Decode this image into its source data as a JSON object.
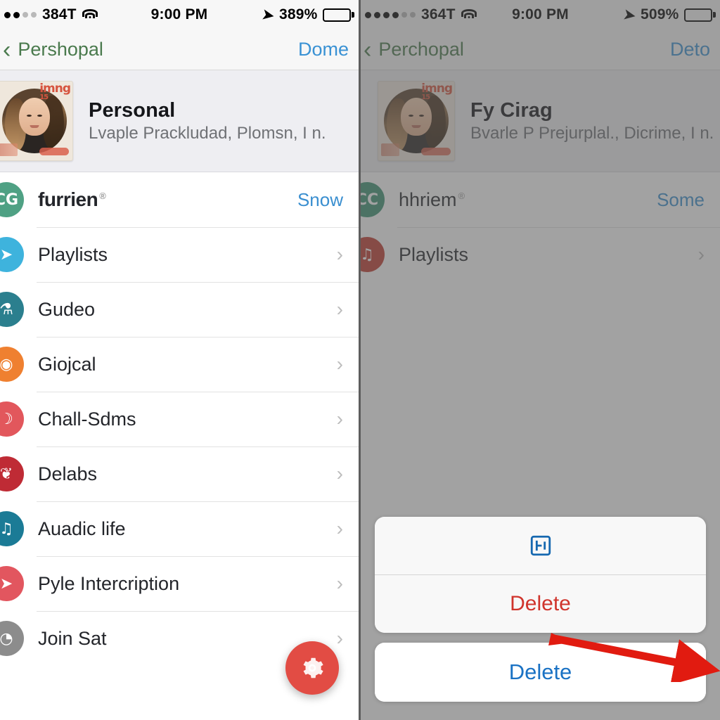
{
  "left_phone": {
    "status_bar": {
      "signal_dots_filled": 2,
      "signal_dots_total": 5,
      "carrier": "384T",
      "wifi_icon": "wifi-icon",
      "time": "9:00 PM",
      "location_icon": "location-arrow-icon",
      "battery_percent": "389%",
      "battery_icon": "battery-full-icon"
    },
    "nav_bar": {
      "back_icon": "chevron-left-icon",
      "back_label": "Pershopal",
      "right_action": "Dome"
    },
    "profile": {
      "avatar_name": "avatar",
      "avatar_watermark": "imng",
      "avatar_watermark_sub": "15",
      "name": "Personal",
      "subtitle": "Lvaple Prackludad, Plomsn, I n."
    },
    "rows": [
      {
        "label": "furrien",
        "sup": "®",
        "value": "Snow",
        "chevron": false,
        "icon_name": "furrien-icon",
        "icon_color": "#4fa184",
        "glyph": "CG",
        "brand": true
      },
      {
        "label": "Playlists",
        "sup": "",
        "value": "",
        "chevron": true,
        "icon_name": "playlists-icon",
        "icon_color": "#3eb3dd",
        "glyph": "➤",
        "brand": false
      },
      {
        "label": "Gudeo",
        "sup": "",
        "value": "",
        "chevron": true,
        "icon_name": "gudeo-icon",
        "icon_color": "#2b7f8e",
        "glyph": "⚗",
        "brand": false
      },
      {
        "label": "Giojcal",
        "sup": "",
        "value": "",
        "chevron": true,
        "icon_name": "giojcal-icon",
        "icon_color": "#ef8030",
        "glyph": "◉",
        "brand": false
      },
      {
        "label": "Chall-Sdms",
        "sup": "",
        "value": "",
        "chevron": true,
        "icon_name": "chall-sdms-icon",
        "icon_color": "#e2575c",
        "glyph": "☽",
        "brand": false
      },
      {
        "label": "Delabs",
        "sup": "",
        "value": "",
        "chevron": true,
        "icon_name": "delabs-icon",
        "icon_color": "#bf2b35",
        "glyph": "❦",
        "brand": false
      },
      {
        "label": "Auadic life",
        "sup": "",
        "value": "",
        "chevron": true,
        "icon_name": "auadic-life-icon",
        "icon_color": "#1b7b96",
        "glyph": "♫",
        "brand": false
      },
      {
        "label": "Pyle Intercription",
        "sup": "",
        "value": "",
        "chevron": true,
        "icon_name": "pyle-intercription-icon",
        "icon_color": "#e2565f",
        "glyph": "➤",
        "brand": false
      },
      {
        "label": "Join Sat",
        "sup": "",
        "value": "",
        "chevron": true,
        "icon_name": "join-sat-icon",
        "icon_color": "#8c8c8c",
        "glyph": "◔",
        "brand": false
      }
    ],
    "fab": {
      "icon_name": "gear-icon",
      "color": "#e24c44"
    }
  },
  "right_phone": {
    "status_bar": {
      "signal_dots_filled": 4,
      "signal_dots_total": 6,
      "carrier": "364T",
      "wifi_icon": "wifi-icon",
      "time": "9:00 PM",
      "location_icon": "location-arrow-icon",
      "battery_percent": "509%",
      "battery_icon": "battery-full-icon"
    },
    "nav_bar": {
      "back_icon": "chevron-left-icon",
      "back_label": "Perchopal",
      "right_action": "Deto"
    },
    "profile": {
      "avatar_name": "avatar",
      "avatar_watermark": "imng",
      "avatar_watermark_sub": "15",
      "name": "Fy Cirag",
      "subtitle": "Bvarle P Prejurplal., Dicrime, I n."
    },
    "rows": [
      {
        "label": "hhriem",
        "sup": "®",
        "value": "Some",
        "chevron": false,
        "icon_name": "hhriem-icon",
        "icon_color": "#3d9272",
        "glyph": "CC",
        "brand": false
      },
      {
        "label": "Playlists",
        "sup": "",
        "value": "",
        "chevron": true,
        "icon_name": "playlists-icon",
        "icon_color": "#c0392f",
        "glyph": "♫",
        "brand": false
      }
    ],
    "action_sheet": {
      "icon_name": "share-square-icon",
      "destructive_label": "Delete",
      "cancel_label": "Delete"
    },
    "annotation": {
      "name": "red-arrow-pointer",
      "color": "#e11b10"
    }
  }
}
